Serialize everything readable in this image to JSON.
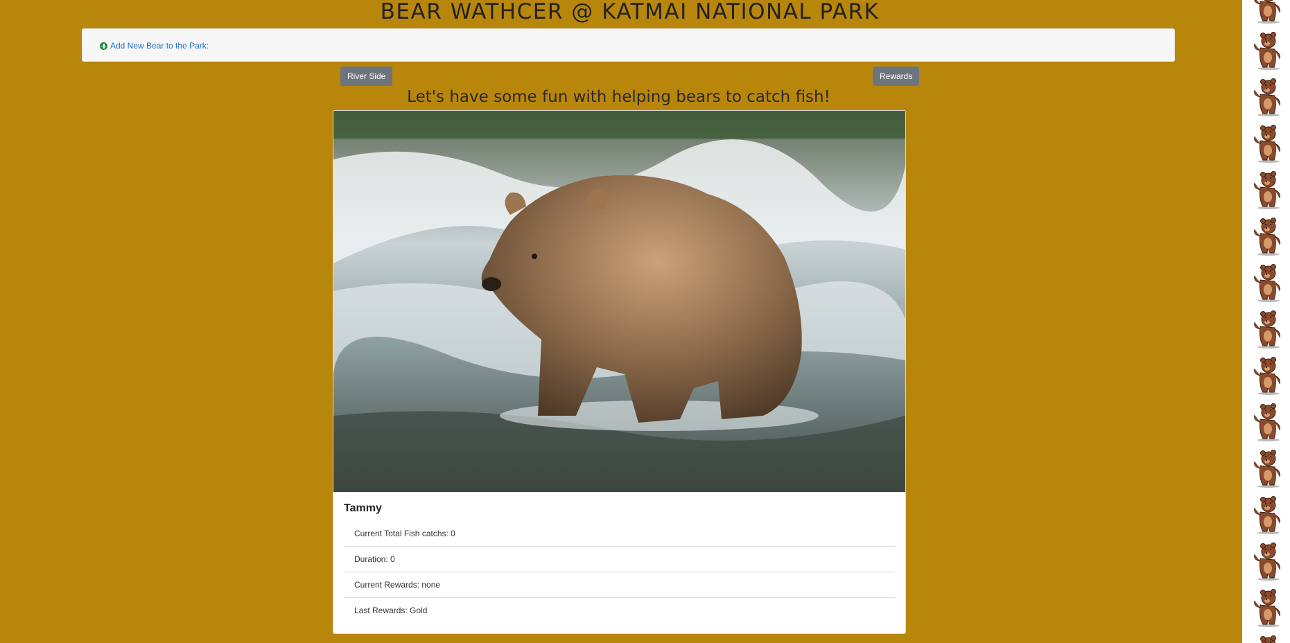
{
  "header": {
    "title": "BEAR WATHCER @ KATMAI NATIONAL PARK"
  },
  "add_panel": {
    "link_label": "Add New Bear to the Park:",
    "icon": "plus-circle-icon"
  },
  "toolbar": {
    "river_side_label": "River Side",
    "rewards_label": "Rewards"
  },
  "main": {
    "subtitle": "Let's have some fun with helping bears to catch fish!"
  },
  "bear_card": {
    "name": "Tammy",
    "photo_alt": "brown bear standing in a river",
    "stats": [
      "Current Total Fish catchs: 0",
      "Duration: 0",
      "Current Rewards: none",
      "Last Rewards: Gold"
    ]
  },
  "decor": {
    "strip_icon": "dancing-bear-icon"
  },
  "colors": {
    "background": "#b8860b",
    "button": "#6c757d",
    "link": "#1a73c9",
    "plus_icon": "#1f8a3a"
  }
}
